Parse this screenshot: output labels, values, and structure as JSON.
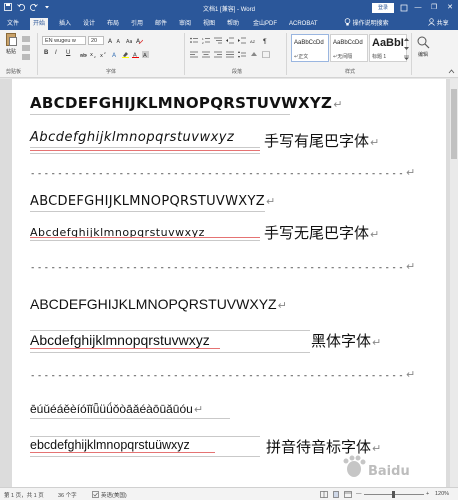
{
  "titlebar": {
    "title": "文档1 [兼容] - Word",
    "login": "登录",
    "minimize": "—",
    "restore": "❐",
    "close": "✕"
  },
  "tabs": [
    {
      "label": "文件"
    },
    {
      "label": "开始"
    },
    {
      "label": "插入"
    },
    {
      "label": "设计"
    },
    {
      "label": "布局"
    },
    {
      "label": "引用"
    },
    {
      "label": "邮件"
    },
    {
      "label": "审阅"
    },
    {
      "label": "视图"
    },
    {
      "label": "帮助"
    },
    {
      "label": "金山PDF"
    },
    {
      "label": "ACROBAT"
    }
  ],
  "tellme": "操作说明搜索",
  "share": "共享",
  "ribbon": {
    "paste_label": "粘贴",
    "clipboard_label": "剪贴板",
    "font_name": "EN wugeu w",
    "font_size": "20",
    "font_group_label": "字体",
    "paragraph_label": "段落",
    "styles_label": "样式",
    "editing_label": "编辑",
    "bold": "B",
    "italic": "I",
    "underline": "U",
    "styles": [
      {
        "sample": "AaBbCcDd",
        "name": "↵正文"
      },
      {
        "sample": "AaBbCcDd",
        "name": "↵无间隔"
      },
      {
        "sample": "AaBbI",
        "name": "标题 1"
      }
    ]
  },
  "document": {
    "sections": [
      {
        "upper": "ABCDEFGHIJKLMNOPQRSTUVWXYZ",
        "lower": "Abcdefghijklmnopqrstuvwxyz",
        "cn": "手写有尾巴字体"
      },
      {
        "upper": "ABCDEFGHIJKLMNOPQRSTUVWXYZ",
        "lower": "Abcdefghijklmnopqrstuvwxyz",
        "cn": "手写无尾巴字体"
      },
      {
        "upper": "ABCDEFGHIJKLMNOPQRSTUVWXYZ",
        "lower": "Abcdefghijklmnopqrstuvwxyz",
        "cn": "黑体字体"
      }
    ],
    "dashes": "-------------------------------------------------------",
    "pinyin_vowels": "ēúǔéáěèíóīǐǖüǘǒòāǎéàōūǎūóu",
    "pinyin_lower": "ebcdefghijklmnopqrstuüwxyz",
    "pinyin_cn": "拼音待音标字体",
    "para_mark": "↵"
  },
  "statusbar": {
    "page": "第 1 页，共 1 页",
    "words": "36 个字",
    "language": "英语(美国)",
    "zoom": "120%"
  },
  "watermark": "Baidu 经验"
}
